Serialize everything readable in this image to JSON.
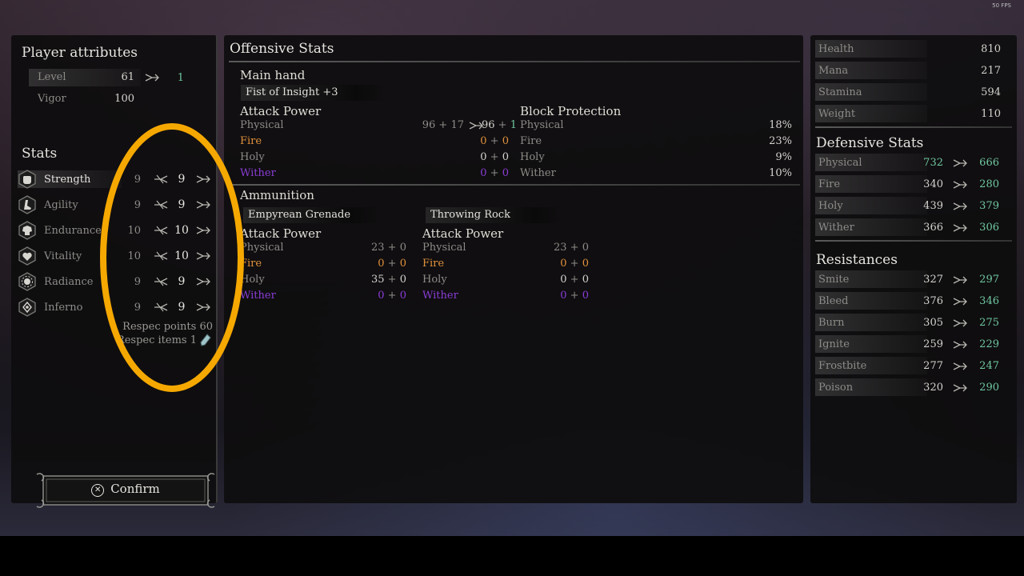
{
  "fps": "50 FPS",
  "left": {
    "title": "Player attributes",
    "attributes": [
      {
        "label": "Level",
        "value": "61",
        "new": "1"
      },
      {
        "label": "Vigor",
        "value": "100"
      }
    ],
    "stats_title": "Stats",
    "stats": [
      {
        "label": "Strength",
        "base": "9",
        "value": "9",
        "icon": "fist-icon"
      },
      {
        "label": "Agility",
        "base": "9",
        "value": "9",
        "icon": "boot-icon"
      },
      {
        "label": "Endurance",
        "base": "10",
        "value": "10",
        "icon": "armor-icon"
      },
      {
        "label": "Vitality",
        "base": "10",
        "value": "10",
        "icon": "heart-icon"
      },
      {
        "label": "Radiance",
        "base": "9",
        "value": "9",
        "icon": "sun-icon"
      },
      {
        "label": "Inferno",
        "base": "9",
        "value": "9",
        "icon": "flame-icon"
      }
    ],
    "respec_points": "Respec points 60",
    "respec_items": "Respec items 1",
    "confirm": "Confirm"
  },
  "mid": {
    "title": "Offensive Stats",
    "main_hand_label": "Main hand",
    "weapon": "Fist of Insight +3",
    "attack_power_label": "Attack Power",
    "block_protection_label": "Block Protection",
    "attack": [
      {
        "label": "Physical",
        "a": "96",
        "op": "+",
        "b": "17",
        "c": "96",
        "op2": "+",
        "d": "1",
        "type": "dim"
      },
      {
        "label": "Fire",
        "a": "0",
        "op": "+",
        "b": "0",
        "type": "fire"
      },
      {
        "label": "Holy",
        "a": "0",
        "op": "+",
        "b": "0",
        "type": "normal"
      },
      {
        "label": "Wither",
        "a": "0",
        "op": "+",
        "b": "0",
        "type": "wither"
      }
    ],
    "block": [
      {
        "label": "Physical",
        "value": "18%",
        "type": "dim"
      },
      {
        "label": "Fire",
        "value": "23%",
        "type": "dim"
      },
      {
        "label": "Holy",
        "value": "9%",
        "type": "dim"
      },
      {
        "label": "Wither",
        "value": "10%",
        "type": "dim"
      }
    ],
    "ammo_label": "Ammunition",
    "ammo": [
      {
        "name": "Empyrean Grenade",
        "attack_power_label": "Attack Power",
        "rows": [
          {
            "label": "Physical",
            "a": "23",
            "op": "+",
            "b": "0",
            "type": "dim"
          },
          {
            "label": "Fire",
            "a": "0",
            "op": "+",
            "b": "0",
            "type": "fire"
          },
          {
            "label": "Holy",
            "a": "35",
            "op": "+",
            "b": "0",
            "type": "normal"
          },
          {
            "label": "Wither",
            "a": "0",
            "op": "+",
            "b": "0",
            "type": "wither"
          }
        ]
      },
      {
        "name": "Throwing Rock",
        "attack_power_label": "Attack Power",
        "rows": [
          {
            "label": "Physical",
            "a": "23",
            "op": "+",
            "b": "0",
            "type": "dim"
          },
          {
            "label": "Fire",
            "a": "0",
            "op": "+",
            "b": "0",
            "type": "fire"
          },
          {
            "label": "Holy",
            "a": "0",
            "op": "+",
            "b": "0",
            "type": "normal"
          },
          {
            "label": "Wither",
            "a": "0",
            "op": "+",
            "b": "0",
            "type": "wither"
          }
        ]
      }
    ]
  },
  "right": {
    "core": [
      {
        "label": "Health",
        "value": "810"
      },
      {
        "label": "Mana",
        "value": "217"
      },
      {
        "label": "Stamina",
        "value": "594"
      },
      {
        "label": "Weight",
        "value": "110"
      }
    ],
    "defensive_title": "Defensive Stats",
    "defensive": [
      {
        "label": "Physical",
        "value": "732",
        "new": "666",
        "value_green": true
      },
      {
        "label": "Fire",
        "value": "340",
        "new": "280"
      },
      {
        "label": "Holy",
        "value": "439",
        "new": "379"
      },
      {
        "label": "Wither",
        "value": "366",
        "new": "306"
      }
    ],
    "resist_title": "Resistances",
    "resistances": [
      {
        "label": "Smite",
        "value": "327",
        "new": "297"
      },
      {
        "label": "Bleed",
        "value": "376",
        "new": "346"
      },
      {
        "label": "Burn",
        "value": "305",
        "new": "275"
      },
      {
        "label": "Ignite",
        "value": "259",
        "new": "229"
      },
      {
        "label": "Frostbite",
        "value": "277",
        "new": "247"
      },
      {
        "label": "Poison",
        "value": "320",
        "new": "290"
      }
    ]
  },
  "colors": {
    "accent_green": "#6fc7a0",
    "fire": "#e0913c",
    "wither": "#8a3dd6",
    "annotation": "#f5a800"
  }
}
